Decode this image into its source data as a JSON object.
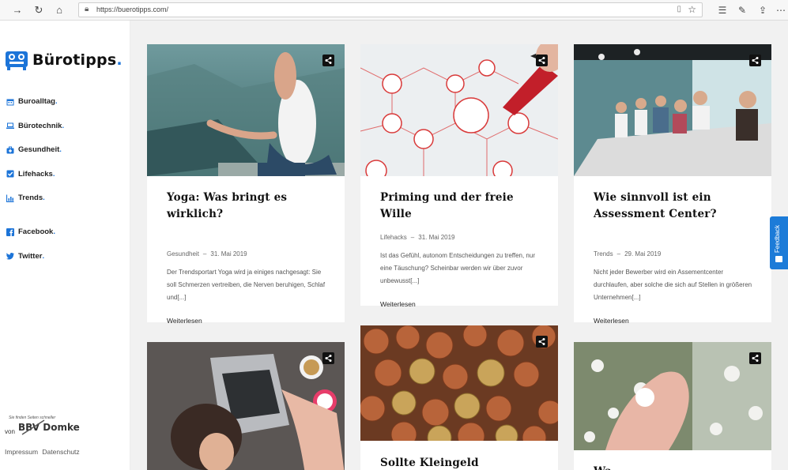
{
  "browser": {
    "url": "https://buerotipps.com/"
  },
  "site": {
    "logo_name": "Bürotipps",
    "logo_dot": "."
  },
  "sidebar": {
    "categories": [
      {
        "label": "Buroalltag",
        "icon": "calendar-icon"
      },
      {
        "label": "Bürotechnik",
        "icon": "laptop-icon"
      },
      {
        "label": "Gesundheit",
        "icon": "medkit-icon"
      },
      {
        "label": "Lifehacks",
        "icon": "checkbox-icon"
      },
      {
        "label": "Trends",
        "icon": "chart-icon"
      }
    ],
    "social": [
      {
        "label": "Facebook",
        "icon": "facebook-icon"
      },
      {
        "label": "Twitter",
        "icon": "twitter-icon"
      }
    ],
    "dot": ".",
    "footer": {
      "von": "von",
      "brand": "BBV Domke",
      "tagline": "Sie finden Seiten schneller",
      "impressum": "Impressum",
      "datenschutz": "Datenschutz"
    }
  },
  "posts": [
    {
      "title": "Yoga: Was bringt es wirklich?",
      "category": "Gesundheit",
      "date": "31. Mai 2019",
      "excerpt": "Der Trendsportart Yoga wird ja einiges nachgesagt: Sie soll Schmerzen vertreiben, die Nerven beruhigen, Schlaf und[...]",
      "more": "Weiterlesen"
    },
    {
      "title": "Priming und der freie Wille",
      "category": "Lifehacks",
      "date": "31. Mai 2019",
      "excerpt": "Ist das Gefühl, autonom Entscheidungen zu treffen, nur eine Täuschung? Scheinbar werden wir über zuvor unbewusst[...]",
      "more": "Weiterlesen"
    },
    {
      "title": "Wie sinnvoll ist ein Assessment Center?",
      "category": "Trends",
      "date": "29. Mai 2019",
      "excerpt": "Nicht jeder Bewerber wird ein Assementcenter durchlaufen, aber solche die sich auf Stellen in größeren Unternehmen[...]",
      "more": "Weiterlesen"
    },
    {
      "title": "",
      "category": "",
      "date": "",
      "excerpt": "",
      "more": ""
    },
    {
      "title": "Sollte Kleingeld abgeschafft",
      "category": "",
      "date": "",
      "excerpt": "",
      "more": ""
    },
    {
      "title": "Wa...",
      "category": "",
      "date": "",
      "excerpt": "",
      "more": ""
    }
  ],
  "meta_separator": "–",
  "feedback_label": "Feedback",
  "colors": {
    "accent": "#1c74d8",
    "page_bg": "#f1f1f1",
    "feedback_bg": "#1c7bd8"
  }
}
